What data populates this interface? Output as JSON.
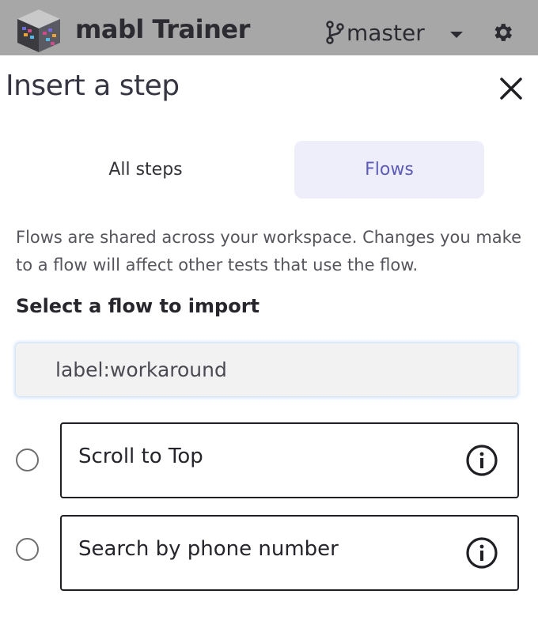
{
  "header": {
    "app_title": "mabl Trainer",
    "branch": "master",
    "logo_icon": "mabl-cube-logo",
    "branch_icon": "git-branch-icon",
    "caret_icon": "caret-down-icon",
    "settings_icon": "gear-icon",
    "colors": {
      "background": "#a7a7a7"
    }
  },
  "panel": {
    "title": "Insert a step",
    "close_icon": "close-icon",
    "tabs": [
      {
        "label": "All steps",
        "selected": false
      },
      {
        "label": "Flows",
        "selected": true
      }
    ],
    "description": "Flows are shared across your workspace. Changes you make to a flow will affect other tests that use the flow.",
    "section_label": "Select a flow to import",
    "search": {
      "value": "label:workaround",
      "placeholder": ""
    },
    "flows": [
      {
        "name": "Scroll to Top",
        "selected": false,
        "info_icon": "info-icon"
      },
      {
        "name": "Search by phone number",
        "selected": false,
        "info_icon": "info-icon"
      }
    ],
    "colors": {
      "accent": "#5d5bb8",
      "tab_selected_bg": "#eeeefb"
    }
  }
}
